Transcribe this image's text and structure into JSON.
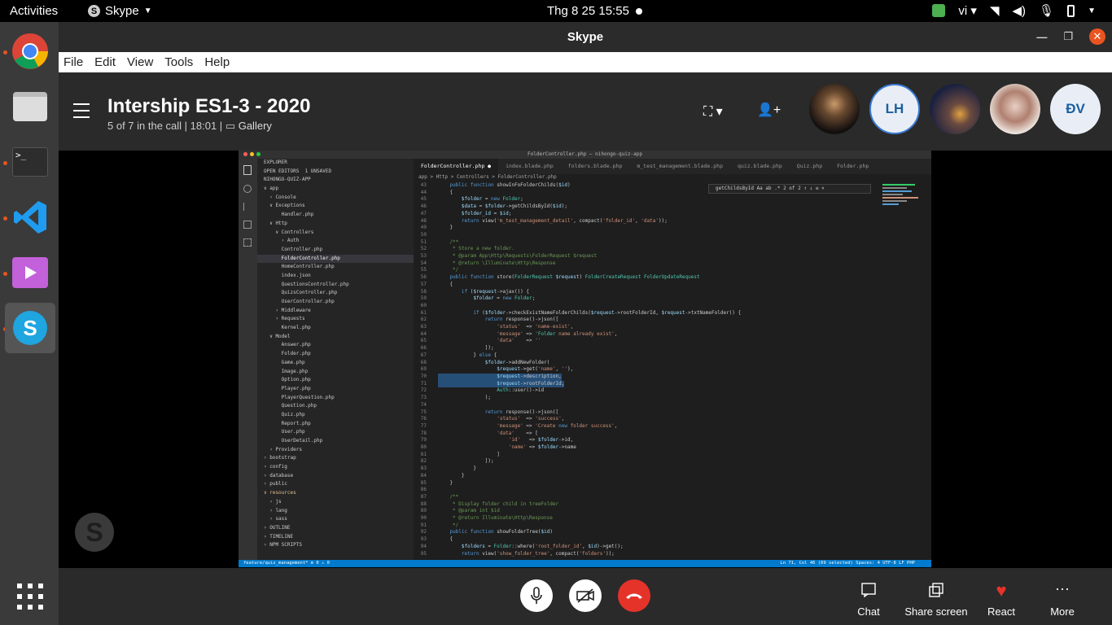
{
  "topbar": {
    "activities": "Activities",
    "app": "Skype",
    "clock": "Thg 8 25  15:55",
    "lang": "vi"
  },
  "window": {
    "title": "Skype"
  },
  "menu": [
    "File",
    "Edit",
    "View",
    "Tools",
    "Help"
  ],
  "call": {
    "title": "Intership ES1-3 - 2020",
    "status": "5 of 7 in the call | 18:01 |",
    "view": "Gallery",
    "participants": [
      {
        "initials": "",
        "color": "#3b2a20"
      },
      {
        "initials": "LH",
        "color": "#e9eef6"
      },
      {
        "initials": "",
        "color": "#2b3550"
      },
      {
        "initials": "",
        "color": "#c9b5b0"
      },
      {
        "initials": "ĐV",
        "color": "#e9eef6"
      }
    ]
  },
  "controls": {
    "chat": "Chat",
    "share": "Share screen",
    "react": "React",
    "more": "More"
  },
  "dock": [
    "chrome",
    "files",
    "terminal",
    "vscode",
    "media-player",
    "skype"
  ],
  "vscode": {
    "title": "FolderController.php — nihongo-quiz-app",
    "tabs": [
      "FolderController.php ●",
      "index.blade.php",
      "folders.blade.php",
      "m_test_management.blade.php",
      "quiz.blade.php",
      "Quiz.php",
      "Folder.php"
    ],
    "breadcrumb": "app > Http > Controllers > FolderController.php",
    "find": "getChildsById     Aa  ab  .*   2 of 2   ↑  ↓  ≡  ×",
    "explorer": [
      "EXPLORER",
      "OPEN EDITORS  1 UNSAVED",
      "NIHONGO-QUIZ-APP",
      "∨ app",
      "  › Console",
      "  ∨ Exceptions",
      "      Handler.php",
      "  ∨ Http",
      "    ∨ Controllers",
      "      › Auth",
      "      Controller.php",
      "      FolderController.php",
      "      HomeController.php",
      "      index.json",
      "      QuestionsController.php",
      "      QuizsController.php",
      "      UserController.php",
      "    › Middleware",
      "    › Requests",
      "      Kernel.php",
      "  ∨ Model",
      "      Answer.php",
      "      Folder.php",
      "      Game.php",
      "      Image.php",
      "      Option.php",
      "      Player.php",
      "      PlayerQuestion.php",
      "      Question.php",
      "      Quiz.php",
      "      Report.php",
      "      User.php",
      "      UserDetail.php",
      "  › Providers",
      "› bootstrap",
      "› config",
      "› database",
      "› public",
      "∨ resources",
      "  › js",
      "  › lang",
      "  › sass",
      "› OUTLINE",
      "› TIMELINE",
      "› NPM SCRIPTS"
    ],
    "code": [
      [
        "43",
        "    public function showInFoFolderChilds($id)"
      ],
      [
        "44",
        "    {"
      ],
      [
        "45",
        "        $folder = new Folder;"
      ],
      [
        "46",
        "        $data = $folder->getChildsById($id);"
      ],
      [
        "47",
        "        $folder_id = $id;"
      ],
      [
        "48",
        "        return view('m_test_management_detail', compact('folder_id', 'data'));"
      ],
      [
        "49",
        "    }"
      ],
      [
        "50",
        ""
      ],
      [
        "51",
        "    /**"
      ],
      [
        "52",
        "     * Store a new folder."
      ],
      [
        "53",
        "     * @param App\\Http\\Requests\\FolderRequest $request"
      ],
      [
        "54",
        "     * @return \\Illuminate\\Http\\Response"
      ],
      [
        "55",
        "     */"
      ],
      [
        "56",
        "    public function store(FolderRequest $request) FolderCreateRequest FolderUpdateRequest"
      ],
      [
        "57",
        "    {"
      ],
      [
        "58",
        "        if ($request->ajax()) {"
      ],
      [
        "59",
        "            $folder = new Folder;"
      ],
      [
        "60",
        ""
      ],
      [
        "61",
        "            if ($folder->checkExistNameFolderChilds($request->rootFolderId, $request->txtNameFolder)) {"
      ],
      [
        "62",
        "                return response()->json(["
      ],
      [
        "63",
        "                    'status'  => 'name-exist',"
      ],
      [
        "64",
        "                    'message' => 'Folder name already exist',"
      ],
      [
        "65",
        "                    'data'    => ''"
      ],
      [
        "66",
        "                ]);"
      ],
      [
        "67",
        "            } else {"
      ],
      [
        "68",
        "                $folder->addNewFolder("
      ],
      [
        "69",
        "                    $request->get('name', ''),"
      ],
      [
        "70",
        "                    $request->description,"
      ],
      [
        "71",
        "                    $request->rootFolderId,"
      ],
      [
        "72",
        "                    Auth::user()->id"
      ],
      [
        "73",
        "                );"
      ],
      [
        "74",
        ""
      ],
      [
        "75",
        "                return response()->json(["
      ],
      [
        "76",
        "                    'status'  => 'success',"
      ],
      [
        "77",
        "                    'message' => 'Create new folder success',"
      ],
      [
        "78",
        "                    'data'    => ["
      ],
      [
        "79",
        "                        'id'   => $folder->id,"
      ],
      [
        "80",
        "                        'name' => $folder->name"
      ],
      [
        "81",
        "                    ]"
      ],
      [
        "82",
        "                ]);"
      ],
      [
        "83",
        "            }"
      ],
      [
        "84",
        "        }"
      ],
      [
        "85",
        "    }"
      ],
      [
        "86",
        ""
      ],
      [
        "87",
        "    /**"
      ],
      [
        "88",
        "     * Display folder child in treeFolder"
      ],
      [
        "89",
        "     * @param int $id"
      ],
      [
        "90",
        "     * @return Illuminate\\Http\\Response"
      ],
      [
        "91",
        "     */"
      ],
      [
        "92",
        "    public function showFolderTree($id)"
      ],
      [
        "93",
        "    {"
      ],
      [
        "94",
        "        $folders = Folder::where('root_folder_id', $id)->get();"
      ],
      [
        "95",
        "        return view('show_folder_tree', compact('folders'));"
      ]
    ],
    "status_left": "feature/quiz_management*   ⊗ 0 ⚠ 0",
    "status_right": "Ln 71, Col 46 (69 selected)   Spaces: 4   UTF-8   LF   PHP"
  }
}
